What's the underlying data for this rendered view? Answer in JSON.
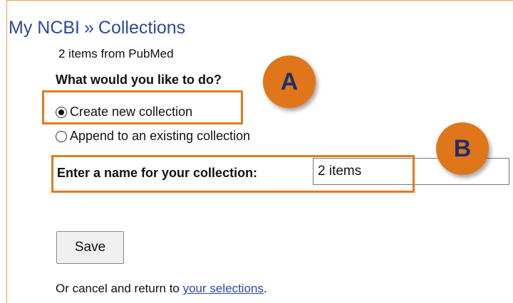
{
  "breadcrumb": {
    "parent": "My NCBI",
    "separator": "»",
    "current": "Collections"
  },
  "subtitle": "2 items from PubMed",
  "question": "What would you like to do?",
  "options": {
    "create": {
      "label": "Create new collection",
      "checked": true
    },
    "append": {
      "label": "Append to an existing collection",
      "checked": false
    }
  },
  "name_field": {
    "label": "Enter a name for your collection:",
    "value": "2 items"
  },
  "save_button": "Save",
  "cancel": {
    "prefix": "Or cancel and return to ",
    "link": "your selections",
    "suffix": "."
  },
  "annotations": {
    "marker_a": "A",
    "marker_b": "B"
  },
  "colors": {
    "highlight": "#e07b1e",
    "link": "#2b4a9a"
  }
}
